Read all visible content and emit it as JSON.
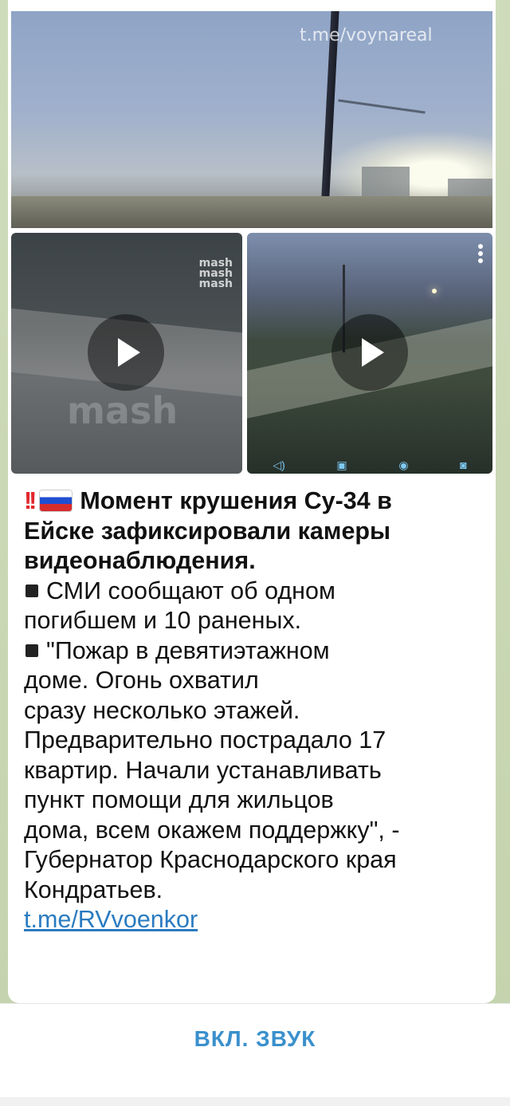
{
  "media": {
    "top_watermark": "t.me/voynareal",
    "left_watermark_lines": [
      "mash",
      "mash",
      "mash"
    ],
    "left_big_watermark": "mash"
  },
  "message": {
    "headline_lines": [
      "Момент крушения Су-34 в",
      "Ейске зафиксировали камеры",
      "видеонаблюдения."
    ],
    "bullet1_lines": [
      "СМИ сообщают об одном",
      "погибшем и 10 раненых."
    ],
    "bullet2_lines": [
      "\"Пожар в девятиэтажном",
      "доме. Огонь охватил",
      "сразу несколько этажей.",
      "Предварительно пострадало 17",
      "квартир. Начали устанавливать",
      "пункт помощи для жильцов",
      "дома, всем окажем поддержку\", -",
      "Губернатор Краснодарского края",
      "Кондратьев."
    ],
    "link": "t.me/RVvoenkor"
  },
  "bottom": {
    "sound_button": "ВКЛ. ЗВУК"
  },
  "colors": {
    "link": "#2a7bc0",
    "accent": "#3a90cc",
    "bang": "#e0282c"
  }
}
